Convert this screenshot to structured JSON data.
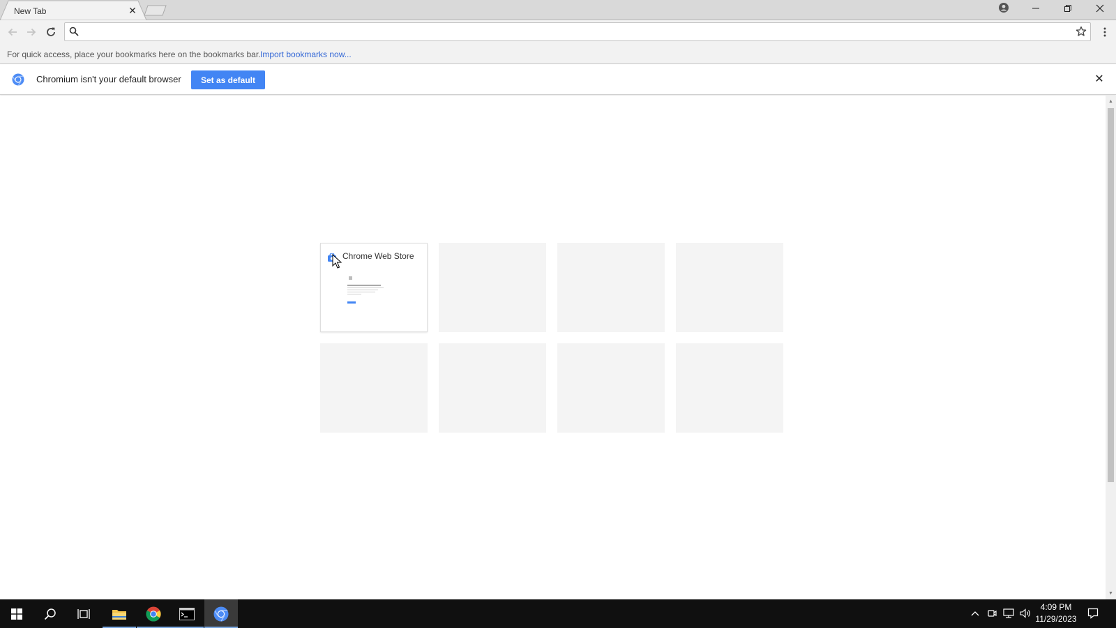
{
  "tabs": [
    {
      "title": "New Tab"
    }
  ],
  "window_controls": {
    "profile": "profile-icon",
    "minimize": "minimize-icon",
    "restore": "restore-icon",
    "close": "close-icon"
  },
  "toolbar": {
    "omnibox_value": "",
    "omnibox_placeholder": ""
  },
  "bookmarks_bar": {
    "message": "For quick access, place your bookmarks here on the bookmarks bar.",
    "import_link": "Import bookmarks now..."
  },
  "infobar": {
    "message": "Chromium isn't your default browser",
    "button_label": "Set as default"
  },
  "most_visited": [
    {
      "title": "Chrome Web Store",
      "filled": true
    },
    {
      "title": "",
      "filled": false
    },
    {
      "title": "",
      "filled": false
    },
    {
      "title": "",
      "filled": false
    },
    {
      "title": "",
      "filled": false
    },
    {
      "title": "",
      "filled": false
    },
    {
      "title": "",
      "filled": false
    },
    {
      "title": "",
      "filled": false
    }
  ],
  "taskbar": {
    "apps": [
      "start-icon",
      "search-icon",
      "task-view-icon",
      "file-explorer-icon",
      "chrome-icon",
      "terminal-icon",
      "chromium-icon"
    ],
    "time": "4:09 PM",
    "date": "11/29/2023"
  },
  "colors": {
    "accent": "#4285f4",
    "link": "#3367d6",
    "taskbar": "#101010"
  }
}
